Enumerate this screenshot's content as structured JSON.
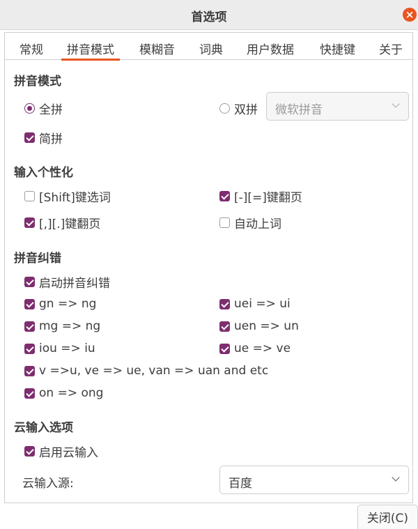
{
  "window": {
    "title": "首选项"
  },
  "tabs": [
    "常规",
    "拼音模式",
    "模糊音",
    "词典",
    "用户数据",
    "快捷键",
    "关于"
  ],
  "pinyin_mode": {
    "title": "拼音模式",
    "full_pinyin": {
      "label": "全拼",
      "selected": true
    },
    "double_pinyin": {
      "label": "双拼",
      "selected": false
    },
    "scheme": {
      "value": "微软拼音",
      "enabled": false
    },
    "initial_pinyin": {
      "label": "简拼",
      "checked": true
    }
  },
  "personalization": {
    "title": "输入个性化",
    "items": [
      {
        "label": "[Shift]键选词",
        "checked": false
      },
      {
        "label": "[-][=]键翻页",
        "checked": true
      },
      {
        "label": "[,][.]键翻页",
        "checked": true
      },
      {
        "label": "自动上词",
        "checked": false
      }
    ]
  },
  "correction": {
    "title": "拼音纠错",
    "enable": {
      "label": "启动拼音纠错",
      "checked": true
    },
    "items": [
      {
        "label": "gn => ng",
        "checked": true
      },
      {
        "label": "uei => ui",
        "checked": true
      },
      {
        "label": "mg => ng",
        "checked": true
      },
      {
        "label": "uen => un",
        "checked": true
      },
      {
        "label": "iou => iu",
        "checked": true
      },
      {
        "label": "ue => ve",
        "checked": true
      },
      {
        "label": "v =>u, ve => ue, van => uan and etc",
        "checked": true
      },
      {
        "label": "on => ong",
        "checked": true
      }
    ]
  },
  "cloud": {
    "title": "云输入选项",
    "enable": {
      "label": "启用云输入",
      "checked": true
    },
    "source_label": "云输入源:",
    "source_value": "百度"
  },
  "buttons": {
    "close": "关闭(C)"
  },
  "colors": {
    "accent": "#e95420",
    "check": "#7e2d6f"
  }
}
